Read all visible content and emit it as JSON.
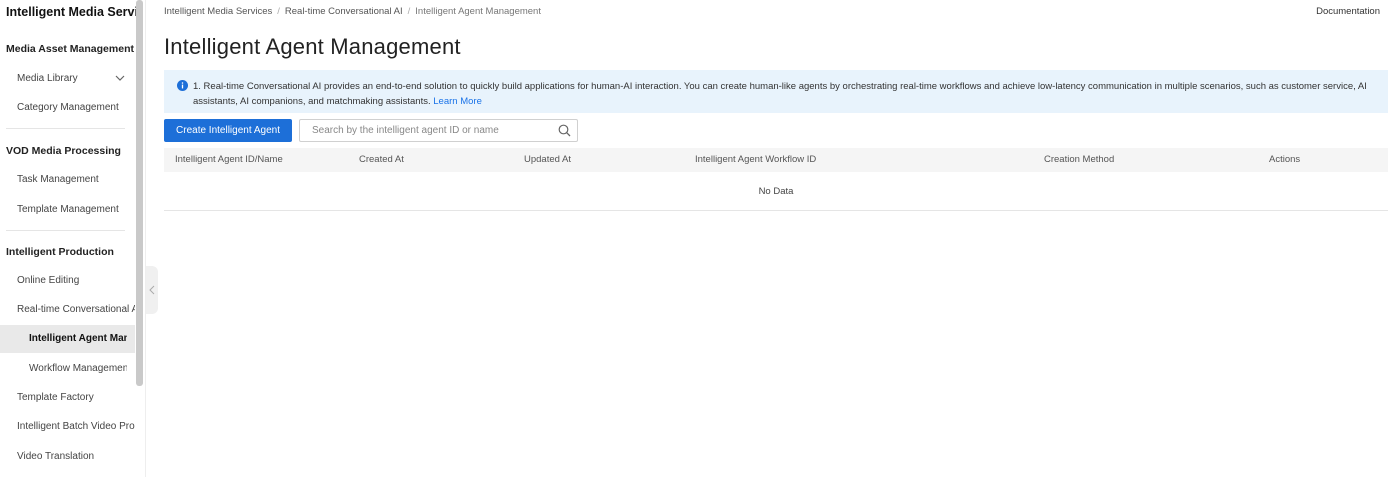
{
  "sidebar": {
    "title": "Intelligent Media Services",
    "groups": {
      "media_asset": "Media Asset Management",
      "vod": "VOD Media Processing",
      "production": "Intelligent Production"
    },
    "items": {
      "media_library": "Media Library",
      "category_management": "Category Management",
      "task_management": "Task Management",
      "template_management": "Template Management",
      "online_editing": "Online Editing",
      "realtime_conversational": "Real-time Conversational AI",
      "intelligent_agent": "Intelligent Agent Management",
      "workflow_management": "Workflow Management",
      "template_factory": "Template Factory",
      "batch_video": "Intelligent Batch Video Production",
      "video_translation": "Video Translation"
    }
  },
  "breadcrumb": {
    "level1": "Intelligent Media Services",
    "level2": "Real-time Conversational AI",
    "level3": "Intelligent Agent Management",
    "separator": "/"
  },
  "header": {
    "documentation": "Documentation",
    "page_title": "Intelligent Agent Management"
  },
  "alert": {
    "text": "1. Real-time Conversational AI provides an end-to-end solution to quickly build applications for human-AI interaction. You can create human-like agents by orchestrating real-time workflows and achieve low-latency communication in multiple scenarios, such as customer service, AI assistants, AI companions, and matchmaking assistants.",
    "link": "Learn More"
  },
  "toolbar": {
    "create_label": "Create Intelligent Agent",
    "search_placeholder": "Search by the intelligent agent ID or name",
    "search_value": ""
  },
  "table": {
    "columns": [
      "Intelligent Agent ID/Name",
      "Created At",
      "Updated At",
      "Intelligent Agent Workflow ID",
      "Creation Method",
      "Actions"
    ],
    "rows": [],
    "empty_text": "No Data"
  },
  "colors": {
    "accent": "#1d6fd8",
    "alert_bg": "#e8f3fc",
    "link": "#1a73e8",
    "active_item_bg": "#e9e9e9"
  }
}
